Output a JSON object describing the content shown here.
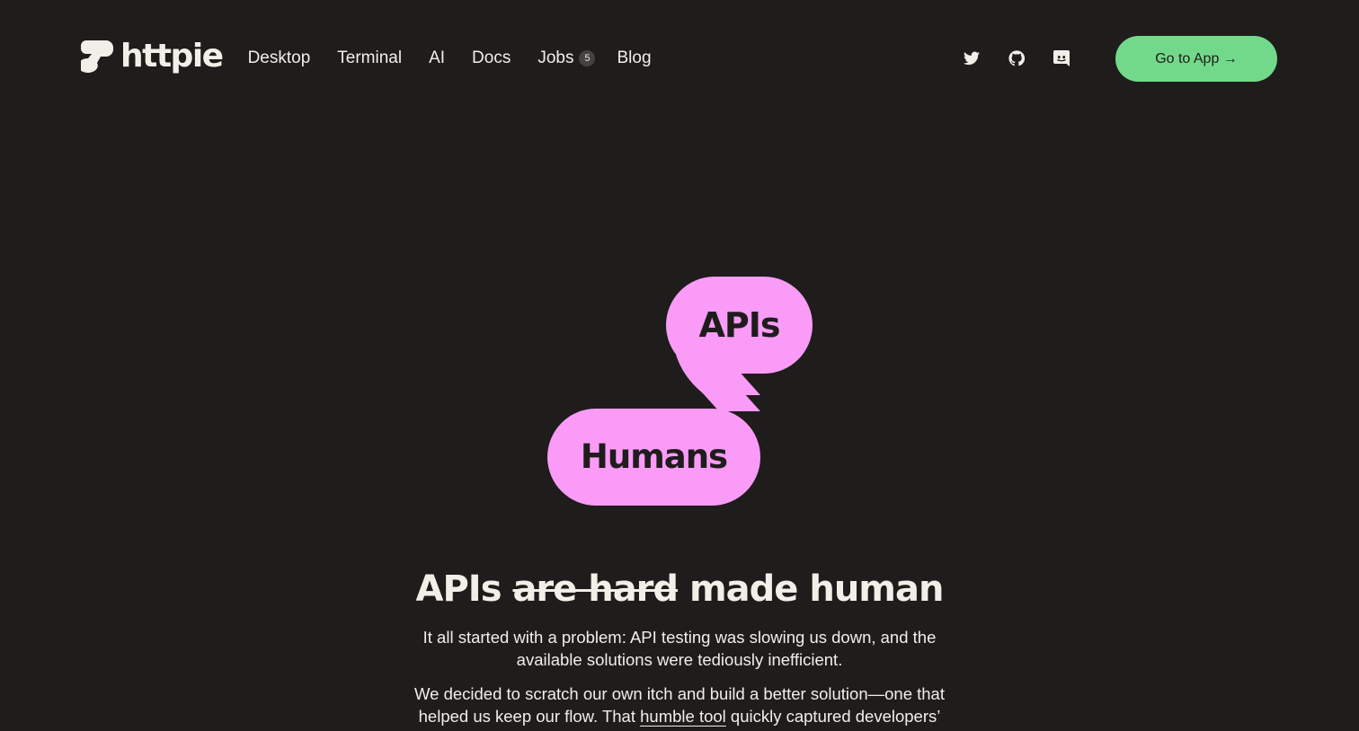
{
  "brand": {
    "name": "httpie"
  },
  "nav": {
    "links": [
      {
        "label": "Desktop"
      },
      {
        "label": "Terminal"
      },
      {
        "label": "AI"
      },
      {
        "label": "Docs"
      },
      {
        "label": "Jobs",
        "badge": "5"
      },
      {
        "label": "Blog"
      }
    ]
  },
  "social": {
    "icons": [
      "twitter-icon",
      "github-icon",
      "discord-icon"
    ]
  },
  "cta": {
    "label": "Go to App →"
  },
  "hero": {
    "pill_top": "APIs",
    "pill_bottom": "Humans",
    "headline_a": "APIs",
    "headline_strike": "are hard",
    "headline_b": "made human",
    "paragraph1": "It all started with a problem: API testing was slowing us down, and the available solutions were tediously inefficient.",
    "paragraph2_a": "We decided to scratch our own itch and build a better solution—one that helped us keep our flow. That",
    "paragraph2_link": "humble tool",
    "paragraph2_b": "quickly captured developers’"
  },
  "colors": {
    "background": "#1f1c1c",
    "text": "#f2efe8",
    "accent_green": "#73d98a",
    "accent_pink": "#f99bf7"
  }
}
